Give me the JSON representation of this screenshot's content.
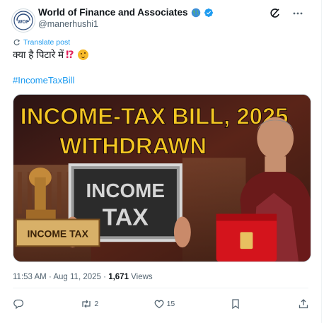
{
  "author": {
    "display_name": "World of Finance and Associates",
    "handle": "@manerhushi1",
    "avatar_text": "WOF",
    "badge_emoji": "globe-emoji",
    "verified_color": "#1d9bf0"
  },
  "post": {
    "translate_label": "Translate post",
    "text": "क्या है पिटारे में",
    "text_emoji_1": "⁉",
    "text_emoji_2": "winking-face",
    "hashtag": "#IncomeTaxBill"
  },
  "media": {
    "headline_line1": "INCOME-TAX BILL, 2025",
    "headline_line2": "WITHDRAWN",
    "board_line1": "INCOME",
    "board_line2": "TAX",
    "stamp_label": "INCOME TAX"
  },
  "meta": {
    "time": "11:53 AM",
    "separator": "·",
    "date": "Aug 11, 2025",
    "views_count": "1,671",
    "views_label": "Views"
  },
  "actions": {
    "reply_count": "",
    "repost_count": "2",
    "like_count": "15",
    "bookmark_count": "",
    "share_count": ""
  },
  "colors": {
    "accent": "#1d9bf0",
    "headline_yellow": "#f3c623",
    "text_secondary": "#536471"
  }
}
